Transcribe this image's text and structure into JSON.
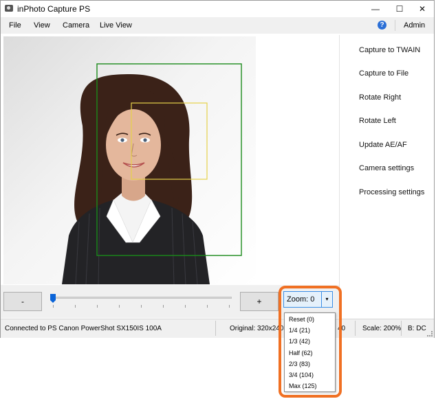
{
  "window": {
    "title": "inPhoto Capture PS",
    "minimize": "—",
    "maximize": "☐",
    "close": "✕"
  },
  "menu": {
    "items": [
      "File",
      "View",
      "Camera",
      "Live View"
    ],
    "help_icon": "?",
    "admin": "Admin"
  },
  "actions": [
    "Capture to TWAIN",
    "Capture to File",
    "Rotate Right",
    "Rotate Left",
    "Update AE/AF",
    "Camera settings",
    "Processing settings"
  ],
  "controls": {
    "minus_label": "-",
    "plus_label": "+",
    "slider_value": 0,
    "zoom_label": "Zoom: 0",
    "zoom_arrow": "▾"
  },
  "zoom_options": [
    "Reset (0)",
    "1/4 (21)",
    "1/3 (42)",
    "Half (62)",
    "2/3 (83)",
    "3/4 (104)",
    "Max (125)"
  ],
  "status": {
    "connection": "Connected to PS Canon PowerShot SX150IS 100A",
    "original": "Original: 320x240",
    "partial": "40",
    "scale": "Scale: 200%",
    "mode": "B: DC"
  },
  "colors": {
    "face_box_outer": "#1a8a1a",
    "face_box_inner": "#e6d24a",
    "highlight": "#f07023",
    "accent": "#0a64d8"
  },
  "icons": {
    "app": "camera-icon",
    "help": "help-icon",
    "dropdown": "chevron-down-icon"
  }
}
